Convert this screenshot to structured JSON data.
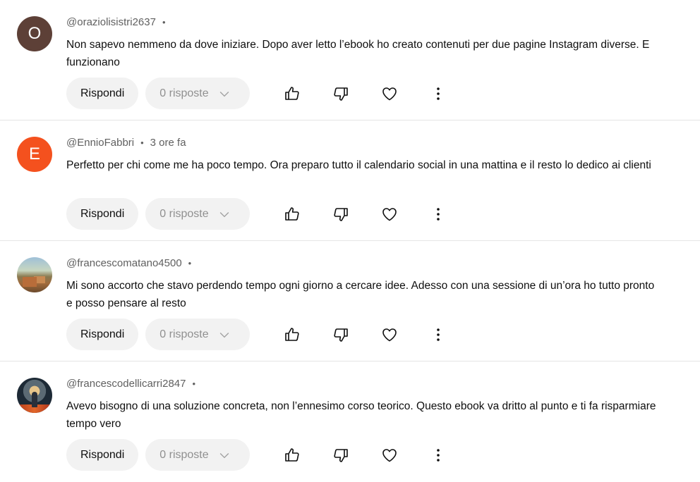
{
  "labels": {
    "reply": "Rispondi",
    "replies": "0 risposte"
  },
  "comments": [
    {
      "author": "@oraziolisistri2637",
      "time": "",
      "avatar_letter": "O",
      "avatar_color": "#5d4037",
      "text": "Non sapevo nemmeno da dove iniziare. Dopo aver letto l’ebook ho creato contenuti per due pagine Instagram diverse. E funzionano"
    },
    {
      "author": "@EnnioFabbri",
      "time": "3 ore fa",
      "avatar_letter": "E",
      "avatar_color": "#f4511e",
      "text": "Perfetto per chi come me ha poco tempo. Ora preparo tutto il calendario social in una mattina e il resto lo dedico ai clienti"
    },
    {
      "author": "@francescomatano4500",
      "time": "",
      "avatar_letter": "",
      "avatar_color": "",
      "text": "Mi sono accorto che stavo perdendo tempo ogni giorno a cercare idee. Adesso con una sessione di un’ora ho tutto pronto e posso pensare al resto"
    },
    {
      "author": "@francescodellicarri2847",
      "time": "",
      "avatar_letter": "",
      "avatar_color": "",
      "text": "Avevo bisogno di una soluzione concreta, non l’ennesimo corso teorico. Questo ebook va dritto al punto e ti fa risparmiare tempo vero"
    }
  ],
  "icons": [
    "thumb-up-icon",
    "thumb-down-icon",
    "heart-icon",
    "more-vert-icon",
    "chevron-down-icon"
  ]
}
